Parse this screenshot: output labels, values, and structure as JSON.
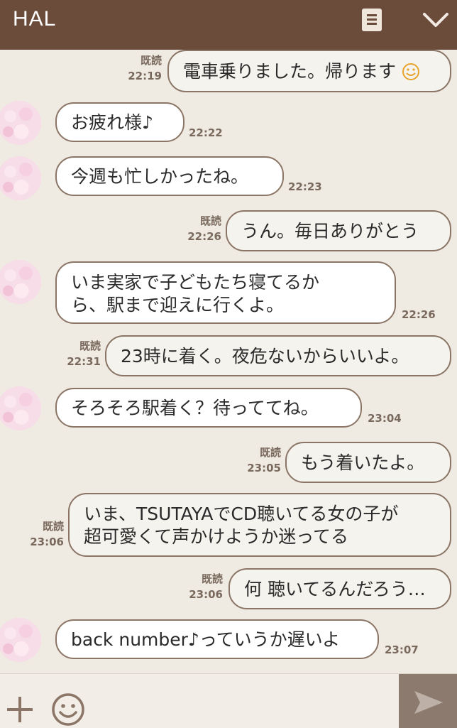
{
  "header": {
    "title": "HAL"
  },
  "messages": [
    {
      "side": "sent",
      "read": "既読",
      "time": "22:19",
      "text": "電車乗りました。帰ります",
      "emoji": "smile"
    },
    {
      "side": "received",
      "time": "22:22",
      "text": "お疲れ様♪"
    },
    {
      "side": "received",
      "time": "22:23",
      "text": "今週も忙しかったね。"
    },
    {
      "side": "sent",
      "read": "既読",
      "time": "22:26",
      "text": "うん。毎日ありがとう"
    },
    {
      "side": "received",
      "time": "22:26",
      "line1": "いま実家で子どもたち寝てるか",
      "line2": "ら、駅まで迎えに行くよ。"
    },
    {
      "side": "sent",
      "read": "既読",
      "time": "22:31",
      "text": "23時に着く。夜危ないからいいよ。"
    },
    {
      "side": "received",
      "time": "23:04",
      "text": "そろそろ駅着く？待っててね。"
    },
    {
      "side": "sent",
      "read": "既読",
      "time": "23:05",
      "text": "もう着いたよ。"
    },
    {
      "side": "sent",
      "read": "既読",
      "time": "23:06",
      "line1": "いま、TSUTAYAでCD聴いてる女の子が",
      "line2": "超可愛くて声かけようか迷ってる"
    },
    {
      "side": "sent",
      "read": "既読",
      "time": "23:06",
      "text": "何 聴いてるんだろう…"
    },
    {
      "side": "received",
      "time": "23:07",
      "text": "back number♪っていうか遅いよ"
    }
  ],
  "colors": {
    "header": "#6b4c3b",
    "background": "#efeae2",
    "send_button": "#8c7a6e",
    "bubble_border": "#8a7566"
  },
  "icons": {
    "menu": "memo-icon",
    "collapse": "chevron-down-icon",
    "attach": "plus-icon",
    "emoji": "emoji-icon",
    "send": "send-icon"
  }
}
